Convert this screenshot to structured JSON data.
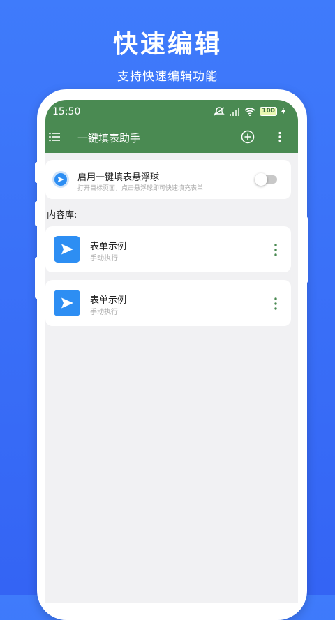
{
  "hero": {
    "title": "快速编辑",
    "subtitle": "支持快速编辑功能"
  },
  "status_bar": {
    "time": "15:50",
    "battery": "100",
    "icons": [
      "mute-icon",
      "signal-icon",
      "wifi-icon",
      "battery-icon",
      "charging-icon"
    ]
  },
  "app_bar": {
    "title": "一键填表助手",
    "icons": [
      "menu-icon",
      "add-icon",
      "more-icon"
    ]
  },
  "floating_ball": {
    "title": "启用一键填表悬浮球",
    "description": "打开目标页面，点击悬浮球即可快速填充表单",
    "enabled": false
  },
  "section_label": "内容库:",
  "items": [
    {
      "title": "表单示例",
      "subtitle": "手动执行"
    },
    {
      "title": "表单示例",
      "subtitle": "手动执行"
    }
  ],
  "colors": {
    "background": "#3f7bfb",
    "app_bar": "#4a8a52",
    "item_icon": "#2d8ef3",
    "kebab": "#4a8a52"
  }
}
